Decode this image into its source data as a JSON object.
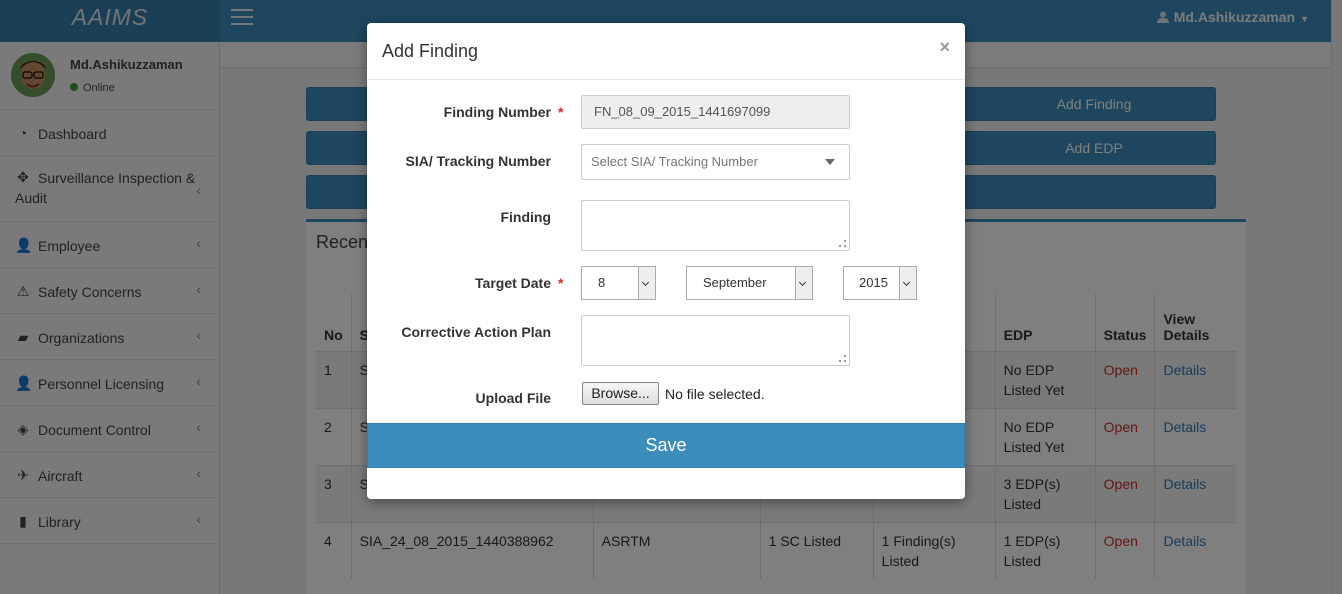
{
  "app": {
    "logo": "AAIMS"
  },
  "topbar": {
    "user": "Md.Ashikuzzaman"
  },
  "sidebar": {
    "user_name": "Md.Ashikuzzaman",
    "user_status": "Online",
    "items": [
      {
        "label": "Dashboard",
        "icon": "dashboard-icon"
      },
      {
        "label": "Surveillance Inspection & Audit",
        "icon": "crosshair-icon"
      },
      {
        "label": "Employee",
        "icon": "user-icon"
      },
      {
        "label": "Safety Concerns",
        "icon": "warning-icon"
      },
      {
        "label": "Organizations",
        "icon": "briefcase-icon"
      },
      {
        "label": "Personnel Licensing",
        "icon": "user-icon"
      },
      {
        "label": "Document Control",
        "icon": "tags-icon"
      },
      {
        "label": "Aircraft",
        "icon": "plane-icon"
      },
      {
        "label": "Library",
        "icon": "book-icon"
      }
    ]
  },
  "main": {
    "buttons": [
      "Add Finding",
      "Add EDP",
      ""
    ],
    "box_title": "Recen",
    "table": {
      "headers": [
        "No",
        "S",
        "",
        "",
        "",
        "EDP",
        "Status",
        "View Details"
      ],
      "rows": [
        {
          "no": "1",
          "sia": "S",
          "org": "",
          "sc": "",
          "findings": "ted",
          "edp": "No EDP Listed Yet",
          "status": "Open",
          "view": "Details"
        },
        {
          "no": "2",
          "sia": "S",
          "org": "",
          "sc": "",
          "findings": "ted",
          "edp": "No EDP Listed Yet",
          "status": "Open",
          "view": "Details"
        },
        {
          "no": "3",
          "sia": "S",
          "org": "",
          "sc": "",
          "findings": "Listed",
          "edp": "3 EDP(s) Listed",
          "status": "Open",
          "view": "Details"
        },
        {
          "no": "4",
          "sia": "SIA_24_08_2015_1440388962",
          "org": "ASRTM",
          "sc": "1 SC Listed",
          "findings": "1 Finding(s) Listed",
          "edp": "1 EDP(s) Listed",
          "status": "Open",
          "view": "Details"
        }
      ]
    }
  },
  "modal": {
    "title": "Add Finding",
    "close": "×",
    "finding_number_label": "Finding Number",
    "finding_number_value": "FN_08_09_2015_1441697099",
    "sia_label": "SIA/ Tracking Number",
    "sia_placeholder": "Select SIA/ Tracking Number",
    "finding_label": "Finding",
    "target_date_label": "Target Date",
    "target_day": "8",
    "target_month": "September",
    "target_year": "2015",
    "cap_label": "Corrective Action Plan",
    "upload_label": "Upload File",
    "browse": "Browse...",
    "no_file": "No file selected.",
    "save": "Save",
    "required_mark": "*"
  }
}
